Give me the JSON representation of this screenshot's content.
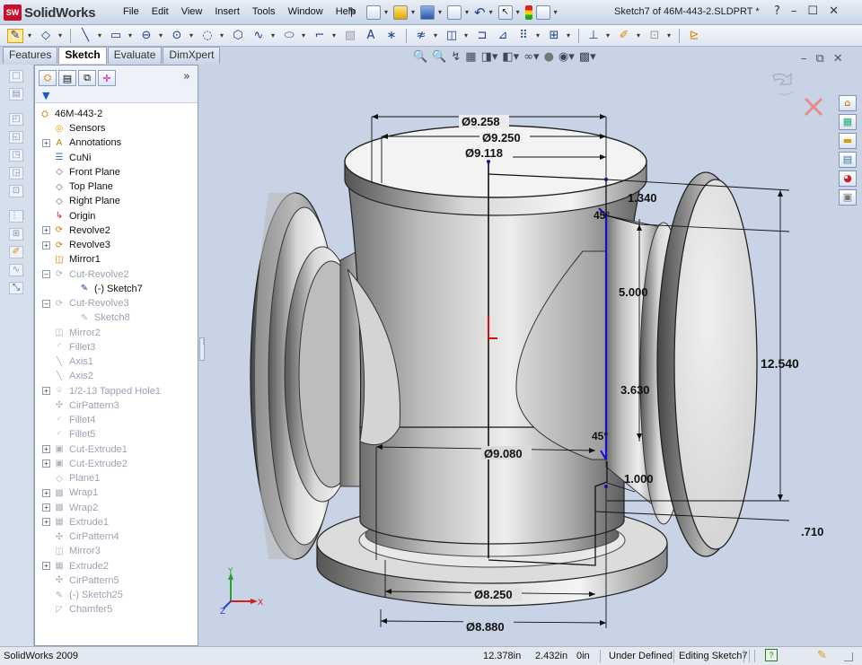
{
  "app": {
    "name_main": "Solid",
    "name_tail": "Works",
    "logo_badge": "SW",
    "document_title": "Sketch7 of 46M-443-2.SLDPRT *",
    "window_buttons": [
      "?",
      "–",
      "☐",
      "✕"
    ]
  },
  "menu": [
    "File",
    "Edit",
    "View",
    "Insert",
    "Tools",
    "Window",
    "Help"
  ],
  "command_manager_tabs": [
    {
      "label": "Features",
      "active": false
    },
    {
      "label": "Sketch",
      "active": true
    },
    {
      "label": "Evaluate",
      "active": false
    },
    {
      "label": "DimXpert",
      "active": false
    }
  ],
  "feature_tree": {
    "root": "46M-443-2",
    "items": [
      {
        "label": "Sensors",
        "icon": "sensor-icon",
        "expand": "",
        "indent": 1,
        "suppressed": false
      },
      {
        "label": "Annotations",
        "icon": "annotation-icon",
        "expand": "+",
        "indent": 1,
        "suppressed": false
      },
      {
        "label": "CuNi",
        "icon": "material-icon",
        "expand": "",
        "indent": 1,
        "suppressed": false
      },
      {
        "label": "Front Plane",
        "icon": "plane-icon",
        "expand": "",
        "indent": 1,
        "suppressed": false
      },
      {
        "label": "Top Plane",
        "icon": "plane-icon",
        "expand": "",
        "indent": 1,
        "suppressed": false
      },
      {
        "label": "Right Plane",
        "icon": "plane-icon",
        "expand": "",
        "indent": 1,
        "suppressed": false
      },
      {
        "label": "Origin",
        "icon": "origin-icon",
        "expand": "",
        "indent": 1,
        "suppressed": false
      },
      {
        "label": "Revolve2",
        "icon": "revolve-icon",
        "expand": "+",
        "indent": 1,
        "suppressed": false
      },
      {
        "label": "Revolve3",
        "icon": "revolve-icon",
        "expand": "+",
        "indent": 1,
        "suppressed": false
      },
      {
        "label": "Mirror1",
        "icon": "mirror-icon",
        "expand": "",
        "indent": 1,
        "suppressed": false
      },
      {
        "label": "Cut-Revolve2",
        "icon": "cut-revolve-icon",
        "expand": "–",
        "indent": 1,
        "suppressed": true
      },
      {
        "label": "(-) Sketch7",
        "icon": "sketch-icon",
        "expand": "",
        "indent": 2,
        "suppressed": false
      },
      {
        "label": "Cut-Revolve3",
        "icon": "cut-revolve-icon",
        "expand": "–",
        "indent": 1,
        "suppressed": true
      },
      {
        "label": "Sketch8",
        "icon": "sketch-icon",
        "expand": "",
        "indent": 2,
        "suppressed": true
      },
      {
        "label": "Mirror2",
        "icon": "mirror-icon",
        "expand": "",
        "indent": 1,
        "suppressed": true
      },
      {
        "label": "Fillet3",
        "icon": "fillet-icon",
        "expand": "",
        "indent": 1,
        "suppressed": true
      },
      {
        "label": "Axis1",
        "icon": "axis-icon",
        "expand": "",
        "indent": 1,
        "suppressed": true
      },
      {
        "label": "Axis2",
        "icon": "axis-icon",
        "expand": "",
        "indent": 1,
        "suppressed": true
      },
      {
        "label": "1/2-13 Tapped Hole1",
        "icon": "hole-icon",
        "expand": "+",
        "indent": 1,
        "suppressed": true
      },
      {
        "label": "CirPattern3",
        "icon": "pattern-icon",
        "expand": "",
        "indent": 1,
        "suppressed": true
      },
      {
        "label": "Fillet4",
        "icon": "fillet-icon",
        "expand": "",
        "indent": 1,
        "suppressed": true
      },
      {
        "label": "Fillet5",
        "icon": "fillet-icon",
        "expand": "",
        "indent": 1,
        "suppressed": true
      },
      {
        "label": "Cut-Extrude1",
        "icon": "cut-extrude-icon",
        "expand": "+",
        "indent": 1,
        "suppressed": true
      },
      {
        "label": "Cut-Extrude2",
        "icon": "cut-extrude-icon",
        "expand": "+",
        "indent": 1,
        "suppressed": true
      },
      {
        "label": "Plane1",
        "icon": "plane-icon",
        "expand": "",
        "indent": 1,
        "suppressed": true
      },
      {
        "label": "Wrap1",
        "icon": "wrap-icon",
        "expand": "+",
        "indent": 1,
        "suppressed": true
      },
      {
        "label": "Wrap2",
        "icon": "wrap-icon",
        "expand": "+",
        "indent": 1,
        "suppressed": true
      },
      {
        "label": "Extrude1",
        "icon": "extrude-icon",
        "expand": "+",
        "indent": 1,
        "suppressed": true
      },
      {
        "label": "CirPattern4",
        "icon": "pattern-icon",
        "expand": "",
        "indent": 1,
        "suppressed": true
      },
      {
        "label": "Mirror3",
        "icon": "mirror-icon",
        "expand": "",
        "indent": 1,
        "suppressed": true
      },
      {
        "label": "Extrude2",
        "icon": "extrude-icon",
        "expand": "+",
        "indent": 1,
        "suppressed": true
      },
      {
        "label": "CirPattern5",
        "icon": "pattern-icon",
        "expand": "",
        "indent": 1,
        "suppressed": true
      },
      {
        "label": "(-) Sketch25",
        "icon": "sketch-icon",
        "expand": "",
        "indent": 1,
        "suppressed": true
      },
      {
        "label": "Chamfer5",
        "icon": "chamfer-icon",
        "expand": "",
        "indent": 1,
        "suppressed": true
      }
    ]
  },
  "dimensions": {
    "d_top1": "Ø9.258",
    "d_top2": "Ø9.250",
    "d_top3": "Ø9.118",
    "d_1340": "1.340",
    "d_angle_top": "45°",
    "d_5000": "5.000",
    "d_12540": "12.540",
    "d_3630": "3.630",
    "d_angle_bottom": "45°",
    "d_9080": "Ø9.080",
    "d_1000": "1.000",
    "d_710": ".710",
    "d_8250": "Ø8.250",
    "d_8880": "Ø8.880"
  },
  "triad": {
    "x": "X",
    "y": "Y",
    "z": "Z"
  },
  "status": {
    "version": "SolidWorks 2009",
    "x": "12.378in",
    "y": "2.432in",
    "z": "0in",
    "state": "Under Defined",
    "mode": "Editing Sketch7"
  },
  "colors": {
    "accent": "#1c3f8c",
    "brand": "#c8102e",
    "sketch_line": "#1010d0",
    "viewport_bg": "#c8d4e6"
  }
}
